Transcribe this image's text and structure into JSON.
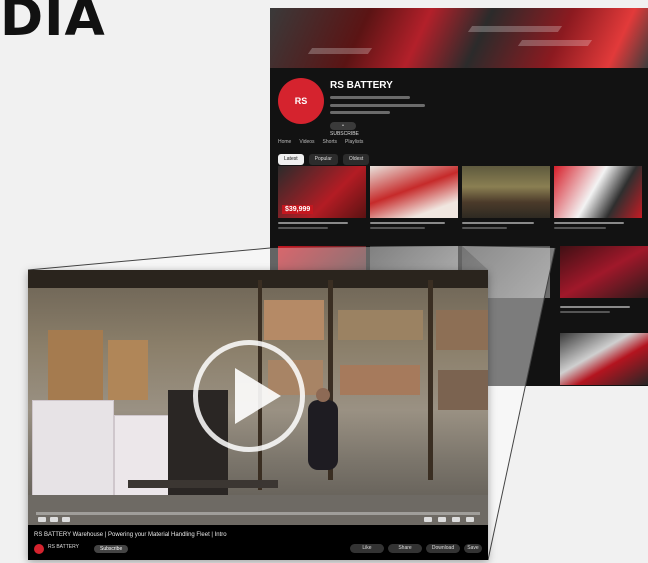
{
  "headline": "DIA",
  "channel": {
    "name": "RS BATTERY",
    "avatar_text": "RS",
    "subscribe_label": "• SUBSCRIBE",
    "tabs": [
      "Home",
      "Videos",
      "Shorts",
      "Playlists"
    ],
    "chips": [
      "Latest",
      "Popular",
      "Oldest"
    ],
    "thumbs": [
      {
        "overlay": "$39,999"
      },
      {
        "overlay": ""
      },
      {
        "overlay": ""
      },
      {
        "overlay": ""
      }
    ]
  },
  "player": {
    "title": "RS BATTERY Warehouse | Powering your Material Handling Fleet | Intro",
    "channel": "RS BATTERY",
    "subscribe": "Subscribe",
    "actions": [
      "Like",
      "Share",
      "Download",
      "Save"
    ],
    "progress_fraction": 0.0
  },
  "colors": {
    "brand_red": "#d5232e",
    "dark_bg": "#121212",
    "page_bg": "#f1f1f1"
  },
  "icons": [
    "play-icon"
  ]
}
